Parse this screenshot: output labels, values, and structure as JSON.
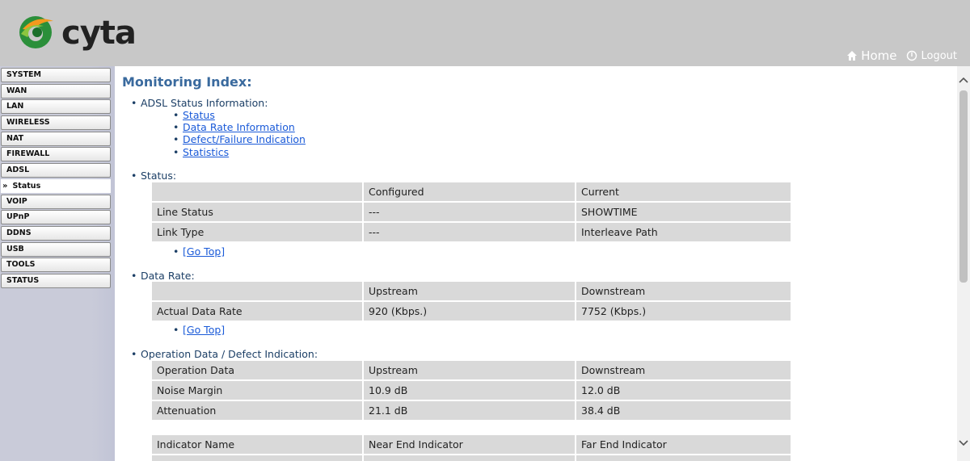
{
  "header": {
    "brand": "cyta",
    "home_label": "Home",
    "logout_label": "Logout"
  },
  "sidebar": {
    "items": [
      {
        "label": "SYSTEM"
      },
      {
        "label": "WAN"
      },
      {
        "label": "LAN"
      },
      {
        "label": "WIRELESS"
      },
      {
        "label": "NAT"
      },
      {
        "label": "FIREWALL"
      },
      {
        "label": "ADSL"
      },
      {
        "label": "Status",
        "sub": true
      },
      {
        "label": "VOIP"
      },
      {
        "label": "UPnP"
      },
      {
        "label": "DDNS"
      },
      {
        "label": "USB"
      },
      {
        "label": "TOOLS"
      },
      {
        "label": "STATUS"
      }
    ],
    "sub_arrow": "»"
  },
  "main": {
    "title": "Monitoring Index:",
    "adsl_section": "ADSL Status Information:",
    "links": [
      "Status",
      "Data Rate Information",
      "Defect/Failure Indication",
      "Statistics"
    ],
    "go_top": "[Go Top]",
    "status_section": "Status:",
    "status_table": {
      "header": [
        "",
        "Configured",
        "Current"
      ],
      "rows": [
        [
          "Line Status",
          "---",
          "SHOWTIME"
        ],
        [
          "Link Type",
          "---",
          "Interleave Path"
        ]
      ]
    },
    "rate_section": "Data Rate:",
    "rate_table": {
      "header": [
        "",
        "Upstream",
        "Downstream"
      ],
      "rows": [
        [
          "Actual Data Rate",
          "920 (Kbps.)",
          "7752 (Kbps.)"
        ]
      ]
    },
    "op_section": "Operation Data / Defect Indication:",
    "op_table": {
      "header": [
        "Operation Data",
        "Upstream",
        "Downstream"
      ],
      "rows": [
        [
          "Noise Margin",
          "10.9 dB",
          "12.0 dB"
        ],
        [
          "Attenuation",
          "21.1 dB",
          "38.4 dB"
        ]
      ]
    },
    "ind_table": {
      "header": [
        "Indicator Name",
        "Near End Indicator",
        "Far End Indicator"
      ]
    }
  },
  "colors": {
    "header_bg": "#c8c8c8",
    "title": "#3a6a9e",
    "link": "#1a5ad8",
    "table_cell": "#d9d9d9",
    "sidebar_bg": "#c9cbd9"
  },
  "icons": {
    "home": "house-icon",
    "logout": "power-icon",
    "scroll_up": "chevron-up-icon",
    "scroll_down": "chevron-down-icon"
  }
}
